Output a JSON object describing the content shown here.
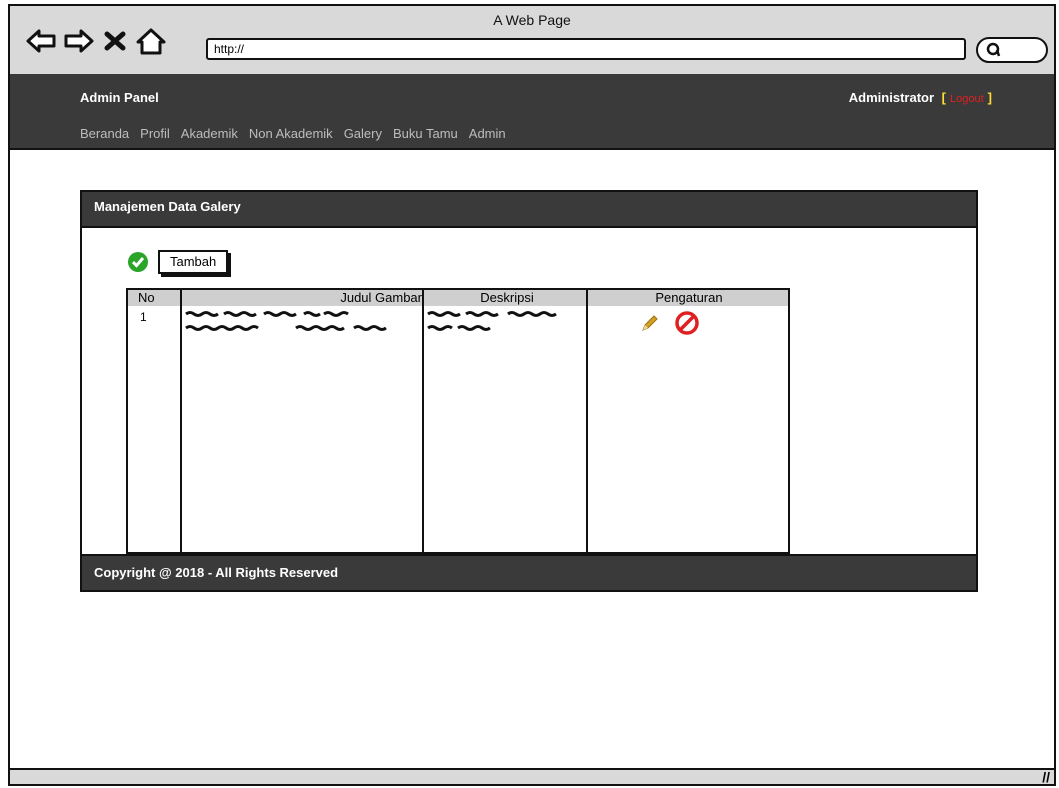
{
  "window": {
    "title": "A Web Page"
  },
  "browser": {
    "url": "http://"
  },
  "header": {
    "brand": "Admin Panel",
    "user": "Administrator",
    "logout": "Logout",
    "menu": [
      "Beranda",
      "Profil",
      "Akademik",
      "Non Akademik",
      "Galery",
      "Buku Tamu",
      "Admin"
    ]
  },
  "panel": {
    "title": "Manajemen Data Galery",
    "add_label": "Tambah",
    "table": {
      "headers": [
        "No",
        "Judul Gambar",
        "Deskripsi",
        "Pengaturan"
      ],
      "rows": [
        {
          "no": "1"
        }
      ]
    },
    "footer": "Copyright @ 2018 - All Rights Reserved"
  },
  "colors": {
    "header_bg": "#3a3a3a",
    "add_icon": "#2aa52a",
    "delete_icon": "#e02020",
    "edit_icon": "#d4a020"
  },
  "icons": [
    "back-icon",
    "forward-icon",
    "close-icon",
    "home-icon",
    "search-icon",
    "check-icon",
    "edit-icon",
    "delete-icon"
  ]
}
